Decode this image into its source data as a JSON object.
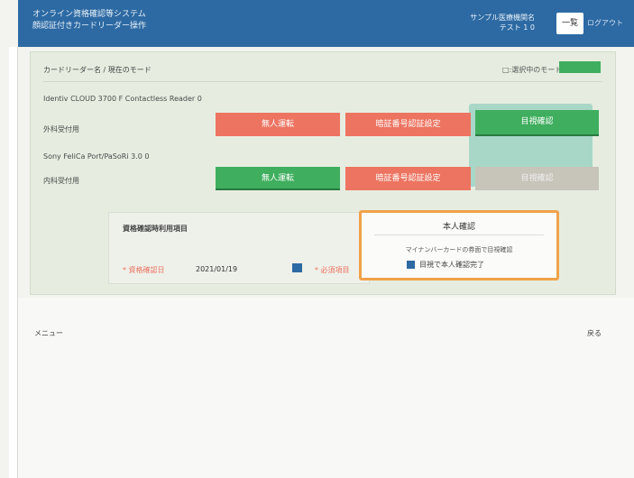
{
  "header": {
    "title_line1": "オンライン資格確認等システム",
    "title_line2": "顔認証付きカードリーダー操作",
    "user_line1": "サンプル医療機関名",
    "user_line2": "テスト 1 0",
    "button_label": "一覧",
    "logout_label": "ログアウト"
  },
  "panel": {
    "breadcrumb": "カードリーダー名 / 現在のモード",
    "legend_label": "□:選択中のモード",
    "legend_color": "#3fae5e",
    "devices": [
      {
        "name": "Identiv CLOUD 3700 F Contactless Reader 0",
        "reception_label": "外科受付用",
        "buttons": [
          "無人運転",
          "暗証番号認証設定",
          "目視確認"
        ],
        "states": [
          "red",
          "red",
          "green"
        ]
      },
      {
        "name": "Sony FeliCa Port/PaSoRi 3.0 0",
        "reception_label": "内科受付用",
        "buttons": [
          "無人運転",
          "暗証番号認証設定",
          "目視確認"
        ],
        "states": [
          "green",
          "red",
          "gray"
        ]
      }
    ]
  },
  "subpanel": {
    "title": "資格確認時利用項目",
    "date_label": "* 資格確認日",
    "date_value": "2021/01/19",
    "more_label": "* 必須項目"
  },
  "popup": {
    "title": "本人確認",
    "description": "マイナンバーカードの券面で目視確認",
    "check_label": "目視で本人確認完了"
  },
  "footer": {
    "menu_label": "メニュー",
    "back_label": "戻る"
  }
}
